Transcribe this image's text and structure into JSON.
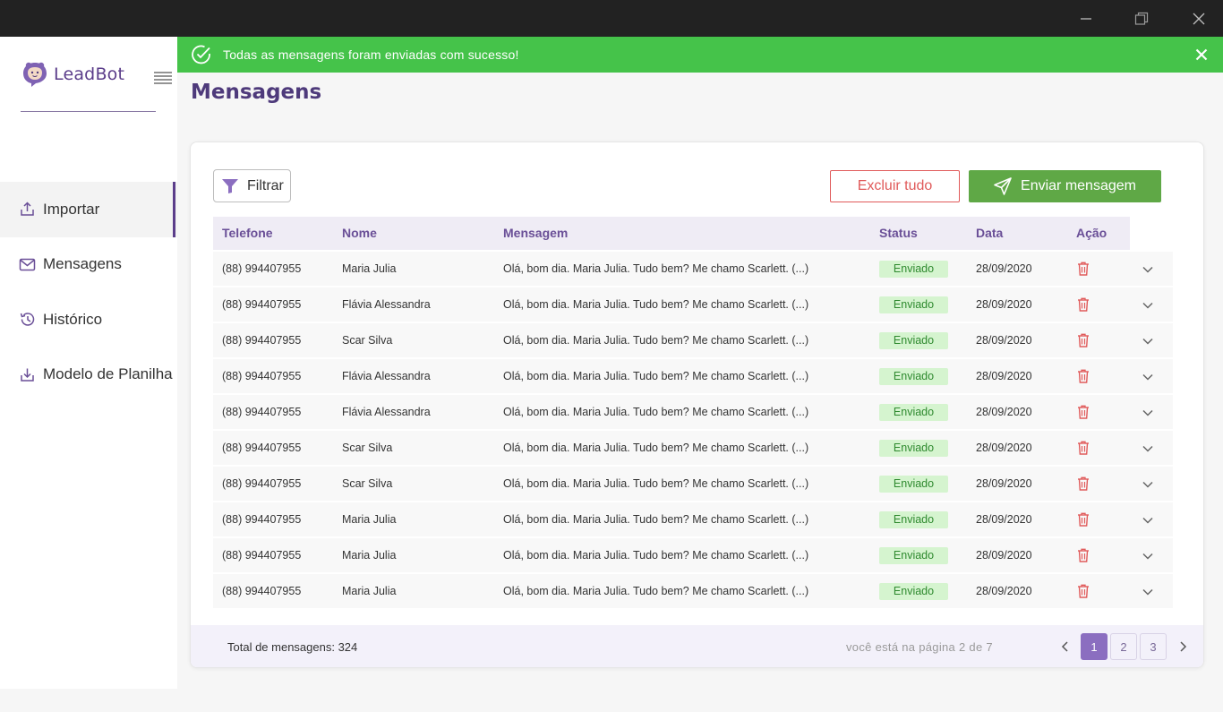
{
  "app": {
    "name": "LeadBot"
  },
  "toast": {
    "message": "Todas as mensagens foram enviadas com sucesso!"
  },
  "sidebar": {
    "items": [
      {
        "label": "Importar",
        "icon": "upload-icon",
        "active": true
      },
      {
        "label": "Mensagens",
        "icon": "mail-icon",
        "active": false
      },
      {
        "label": "Histórico",
        "icon": "history-icon",
        "active": false
      },
      {
        "label": "Modelo de Planilha",
        "icon": "download-icon",
        "active": false
      }
    ]
  },
  "page": {
    "title": "Mensagens"
  },
  "toolbar": {
    "filter_label": "Filtrar",
    "delete_all_label": "Excluir tudo",
    "send_label": "Enviar mensagem"
  },
  "table": {
    "columns": [
      "Telefone",
      "Nome",
      "Mensagem",
      "Status",
      "Data",
      "Ação"
    ],
    "rows": [
      {
        "telefone": "(88) 994407955",
        "nome": "Maria Julia",
        "mensagem": "Olá, bom dia. Maria Julia. Tudo bem? Me chamo Scarlett. (...)",
        "status": "Enviado",
        "data": "28/09/2020"
      },
      {
        "telefone": "(88) 994407955",
        "nome": "Flávia Alessandra",
        "mensagem": "Olá, bom dia. Maria Julia. Tudo bem? Me chamo Scarlett. (...)",
        "status": "Enviado",
        "data": "28/09/2020"
      },
      {
        "telefone": "(88) 994407955",
        "nome": "Scar Silva",
        "mensagem": "Olá, bom dia. Maria Julia. Tudo bem? Me chamo Scarlett. (...)",
        "status": "Enviado",
        "data": "28/09/2020"
      },
      {
        "telefone": "(88) 994407955",
        "nome": "Flávia Alessandra",
        "mensagem": "Olá, bom dia. Maria Julia. Tudo bem? Me chamo Scarlett. (...)",
        "status": "Enviado",
        "data": "28/09/2020"
      },
      {
        "telefone": "(88) 994407955",
        "nome": "Flávia Alessandra",
        "mensagem": "Olá, bom dia. Maria Julia. Tudo bem? Me chamo Scarlett. (...)",
        "status": "Enviado",
        "data": "28/09/2020"
      },
      {
        "telefone": "(88) 994407955",
        "nome": "Scar Silva",
        "mensagem": "Olá, bom dia. Maria Julia. Tudo bem? Me chamo Scarlett. (...)",
        "status": "Enviado",
        "data": "28/09/2020"
      },
      {
        "telefone": "(88) 994407955",
        "nome": "Scar Silva",
        "mensagem": "Olá, bom dia. Maria Julia. Tudo bem? Me chamo Scarlett. (...)",
        "status": "Enviado",
        "data": "28/09/2020"
      },
      {
        "telefone": "(88) 994407955",
        "nome": "Maria Julia",
        "mensagem": "Olá, bom dia. Maria Julia. Tudo bem? Me chamo Scarlett. (...)",
        "status": "Enviado",
        "data": "28/09/2020"
      },
      {
        "telefone": "(88) 994407955",
        "nome": "Maria Julia",
        "mensagem": "Olá, bom dia. Maria Julia. Tudo bem? Me chamo Scarlett. (...)",
        "status": "Enviado",
        "data": "28/09/2020"
      },
      {
        "telefone": "(88) 994407955",
        "nome": "Maria Julia",
        "mensagem": "Olá, bom dia. Maria Julia. Tudo bem? Me chamo Scarlett. (...)",
        "status": "Enviado",
        "data": "28/09/2020"
      }
    ]
  },
  "footer": {
    "total_label": "Total de mensagens: 324",
    "page_info": "você está na página 2 de 7",
    "pages": [
      "1",
      "2",
      "3"
    ],
    "active_page": "1"
  },
  "colors": {
    "brand": "#5b3d8a",
    "success": "#45c34a",
    "send_button": "#5fa846",
    "danger": "#e05a5a"
  }
}
